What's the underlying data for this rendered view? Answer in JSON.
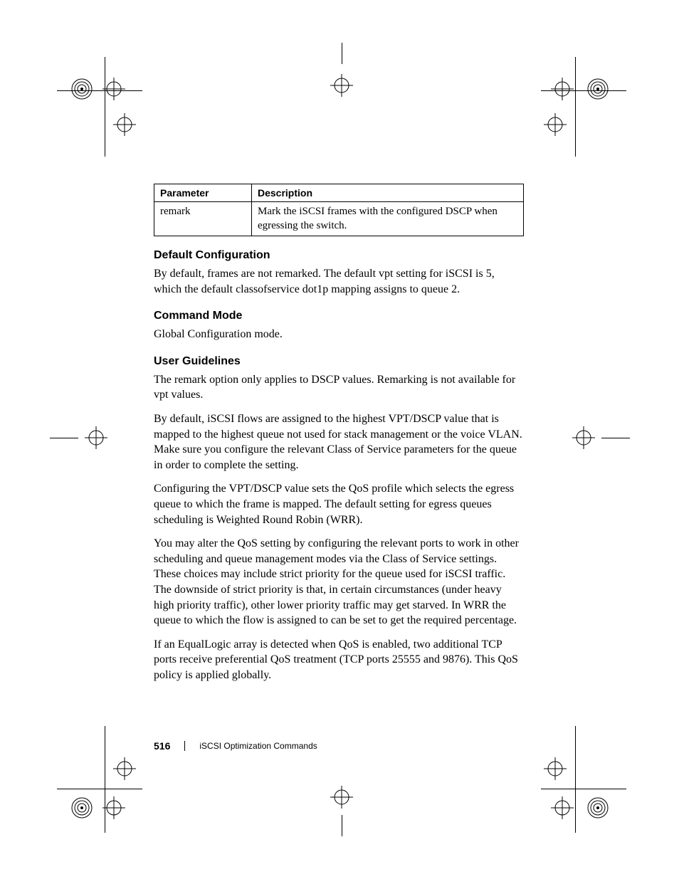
{
  "table": {
    "headers": {
      "param": "Parameter",
      "desc": "Description"
    },
    "rows": [
      {
        "param": "remark",
        "desc": "Mark the iSCSI frames with the configured DSCP when egressing the switch."
      }
    ]
  },
  "sections": {
    "defaultConfig": {
      "heading": "Default Configuration",
      "p1": "By default, frames are not remarked. The default vpt setting for iSCSI is 5, which the default classofservice dot1p mapping assigns to queue 2."
    },
    "commandMode": {
      "heading": "Command Mode",
      "p1": "Global Configuration mode."
    },
    "userGuidelines": {
      "heading": "User Guidelines",
      "p1": "The remark option only applies to DSCP values. Remarking is not available for vpt values.",
      "p2": "By default, iSCSI flows are assigned to the highest VPT/DSCP value that is mapped to the highest queue not used for stack management or the voice VLAN. Make sure you configure the relevant Class of Service parameters for the queue in order to complete the setting.",
      "p3": "Configuring the VPT/DSCP value sets the QoS profile which selects the egress queue to which the frame is mapped. The default setting for egress queues scheduling is Weighted Round Robin (WRR).",
      "p4": "You may alter the QoS setting by configuring the relevant ports to work in other scheduling and queue management modes via the Class of Service settings. These choices may include strict priority for the queue used for iSCSI traffic. The downside of strict priority is that, in certain circumstances (under heavy high priority traffic), other lower priority traffic may get starved. In WRR the queue to which the flow is assigned to can be set to get the required percentage.",
      "p5": "If an EqualLogic array is detected when QoS is enabled, two additional TCP ports receive preferential QoS treatment (TCP ports 25555 and 9876). This QoS policy is applied globally."
    }
  },
  "footer": {
    "page": "516",
    "chapter": "iSCSI Optimization Commands"
  }
}
